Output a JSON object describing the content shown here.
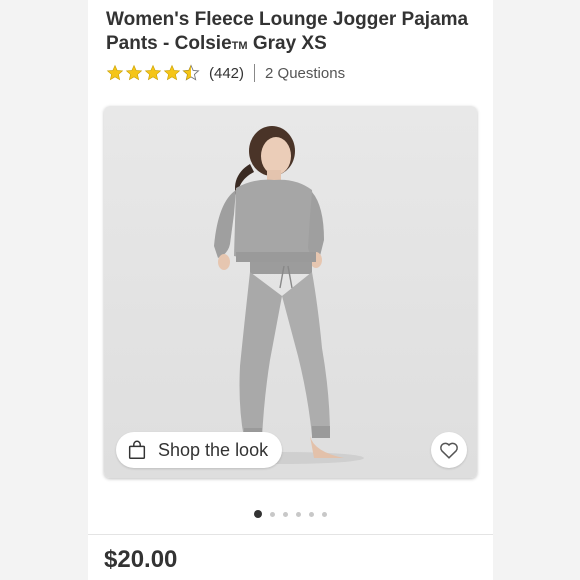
{
  "product": {
    "title_line1": "Women's Fleece Lounge Jogger Pajama",
    "title_line2_prefix": "Pants - Colsie",
    "title_tm": "TM",
    "title_line2_suffix": " Gray XS",
    "rating_value": 4.5,
    "rating_count": "(442)",
    "questions": "2 Questions",
    "price": "$20.00"
  },
  "image": {
    "shop_the_look": "Shop the look",
    "carousel_total": 6,
    "carousel_active": 1
  },
  "colors": {
    "star": "#f5c518",
    "text": "#333333",
    "garment": "#a9a9a9"
  }
}
